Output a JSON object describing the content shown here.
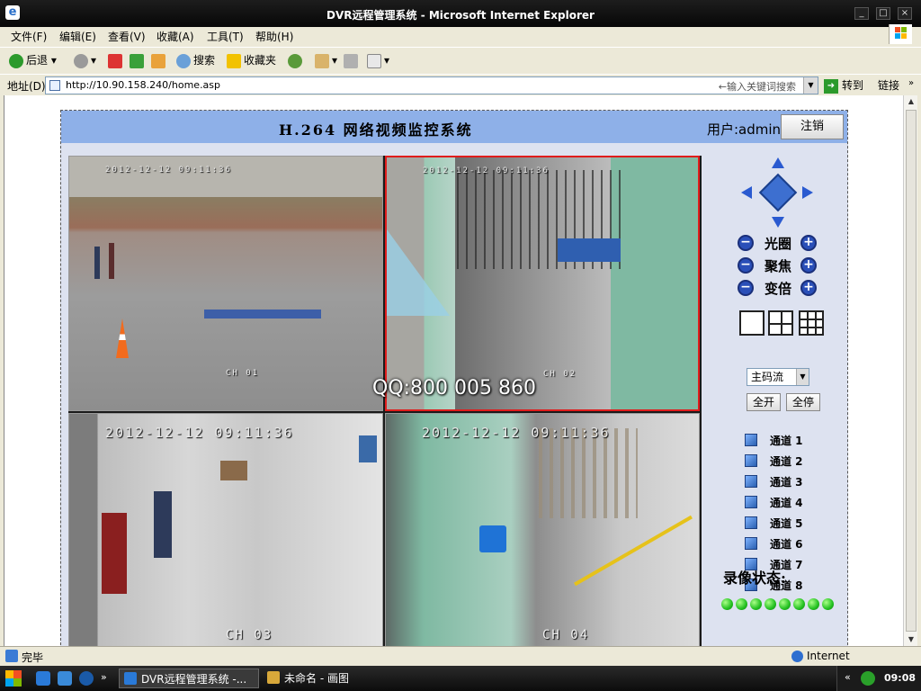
{
  "window": {
    "title": "DVR远程管理系统 - Microsoft Internet Explorer",
    "min": "_",
    "max": "□",
    "close": "×"
  },
  "menu": [
    "文件(F)",
    "编辑(E)",
    "查看(V)",
    "收藏(A)",
    "工具(T)",
    "帮助(H)"
  ],
  "toolbar": {
    "back": "后退",
    "search": "搜索",
    "favorites": "收藏夹"
  },
  "address": {
    "label": "地址(D)",
    "url": "http://10.90.158.240/home.asp",
    "search_hint": "←输入关键词搜索",
    "go": "转到",
    "links": "链接"
  },
  "page": {
    "system_title": "H.264 网络视频监控系统",
    "user_label": "用户:admin",
    "logout_label": "注销",
    "watermark": "QQ:800 005 860",
    "cameras": [
      {
        "channel_label": "CH 01",
        "timestamp": "2012-12-12 09:11:36"
      },
      {
        "channel_label": "CH 02",
        "timestamp": "2012-12-12 09:11:36"
      },
      {
        "channel_label": "CH 03",
        "timestamp": "2012-12-12 09:11:36"
      },
      {
        "channel_label": "CH 04",
        "timestamp": "2012-12-12 09:11:36"
      }
    ],
    "selected_camera": 2,
    "controls": {
      "iris": "光圈",
      "focus": "聚焦",
      "zoom": "变倍",
      "minus": "−",
      "plus": "+"
    },
    "stream": {
      "selected": "主码流"
    },
    "open_all": "全开",
    "stop_all": "全停",
    "channels": [
      "通道 1",
      "通道 2",
      "通道 3",
      "通道 4",
      "通道 5",
      "通道 6",
      "通道 7",
      "通道 8"
    ],
    "record_status_label": "录像状态:",
    "record_indicators": 8
  },
  "statusbar": {
    "status": "完毕",
    "zone": "Internet"
  },
  "taskbar": {
    "items": [
      "DVR远程管理系统 -...",
      "未命名 - 画图"
    ],
    "clock": "09:08",
    "chevron": "»"
  },
  "colors": {
    "header_bg": "#8eb0e8",
    "panel_bg": "#dde2f0",
    "selection_border": "#e01c1c",
    "led_on": "#22c020"
  }
}
